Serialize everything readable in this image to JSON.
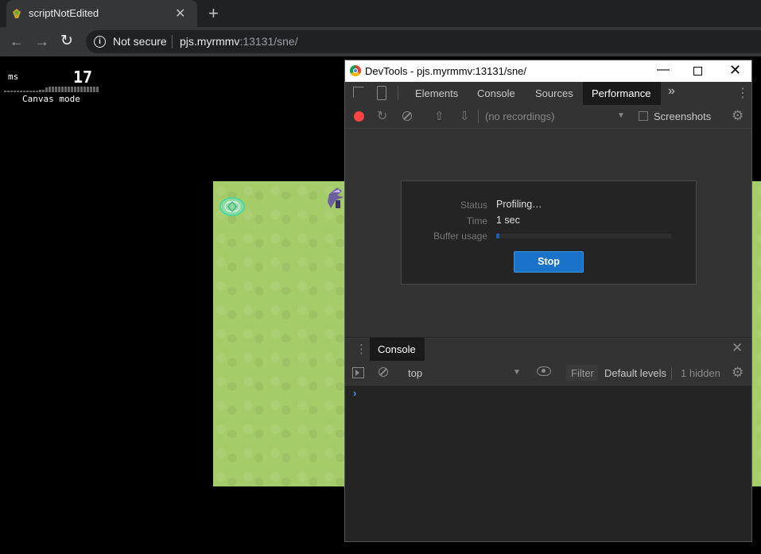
{
  "browser": {
    "tab_title": "scriptNotEdited",
    "tab_close": "✕",
    "new_tab": "+",
    "security": "Not secure",
    "url_host": "pjs.myrmmv",
    "url_rest": ":13131/sne/"
  },
  "page": {
    "fps_unit": "ms",
    "fps_value": "17",
    "mode": "Canvas mode"
  },
  "devtools": {
    "window_title": "DevTools - pjs.myrmmv:13131/sne/",
    "tabs": [
      "Elements",
      "Console",
      "Sources",
      "Performance"
    ],
    "active_tab": "Performance",
    "recordings": "(no recordings)",
    "screenshots_label": "Screenshots",
    "status": {
      "status_label": "Status",
      "status_value": "Profiling…",
      "time_label": "Time",
      "time_value": "1 sec",
      "buffer_label": "Buffer usage",
      "buffer_fraction": 0.02,
      "stop_label": "Stop"
    },
    "drawer": {
      "tab": "Console",
      "context": "top",
      "filter_placeholder": "Filter",
      "levels": "Default levels",
      "hidden": "1 hidden",
      "prompt": "›"
    },
    "colors": {
      "record": "#ff4444",
      "stop_button": "#1a73c8",
      "buffer_fill": "#1a5fb4"
    }
  }
}
